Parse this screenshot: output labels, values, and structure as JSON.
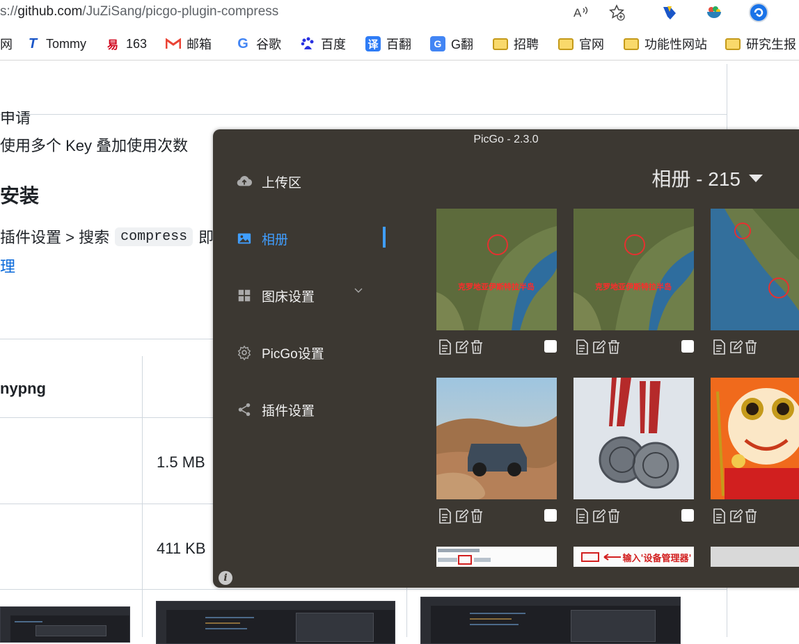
{
  "browser": {
    "url_prefix": "s://",
    "url_host": "github.com",
    "url_path": "/JuZiSang/picgo-plugin-compress",
    "bookmarks": [
      {
        "label": "网",
        "icon": "partial"
      },
      {
        "label": "Tommy",
        "icon": "T"
      },
      {
        "label": "163",
        "icon": "163"
      },
      {
        "label": "邮箱",
        "icon": "M"
      },
      {
        "label": "谷歌",
        "icon": "G"
      },
      {
        "label": "百度",
        "icon": "du"
      },
      {
        "label": "百翻",
        "icon": "译"
      },
      {
        "label": "G翻",
        "icon": "G"
      },
      {
        "label": "招聘",
        "icon": "folder"
      },
      {
        "label": "官网",
        "icon": "folder"
      },
      {
        "label": "功能性网站",
        "icon": "folder"
      },
      {
        "label": "研究生报",
        "icon": "folder"
      }
    ]
  },
  "github": {
    "line1": "申请",
    "line2": "使用多个 Key 叠加使用次数",
    "heading": "安装",
    "install_prefix": "插件设置 > 搜索",
    "install_code": "compress",
    "install_suffix": "即",
    "link_fragment": "理",
    "table_header": "nypng",
    "size1": "1.5 MB",
    "size2": "411 KB"
  },
  "picgo": {
    "title": "PicGo - 2.3.0",
    "nav": [
      {
        "label": "上传区",
        "icon": "cloud-upload-icon"
      },
      {
        "label": "相册",
        "icon": "image-icon"
      },
      {
        "label": "图床设置",
        "icon": "grid-icon"
      },
      {
        "label": "PicGo设置",
        "icon": "gear-icon"
      },
      {
        "label": "插件设置",
        "icon": "share-icon"
      }
    ],
    "active_nav": "相册",
    "album_title": "相册 - 215",
    "map_caption": "克罗地亚伊斯特拉半岛",
    "doc_caption": "输入'设备管理器'"
  },
  "colors": {
    "accent": "#409eff",
    "picgo_bg": "#3c3832"
  }
}
